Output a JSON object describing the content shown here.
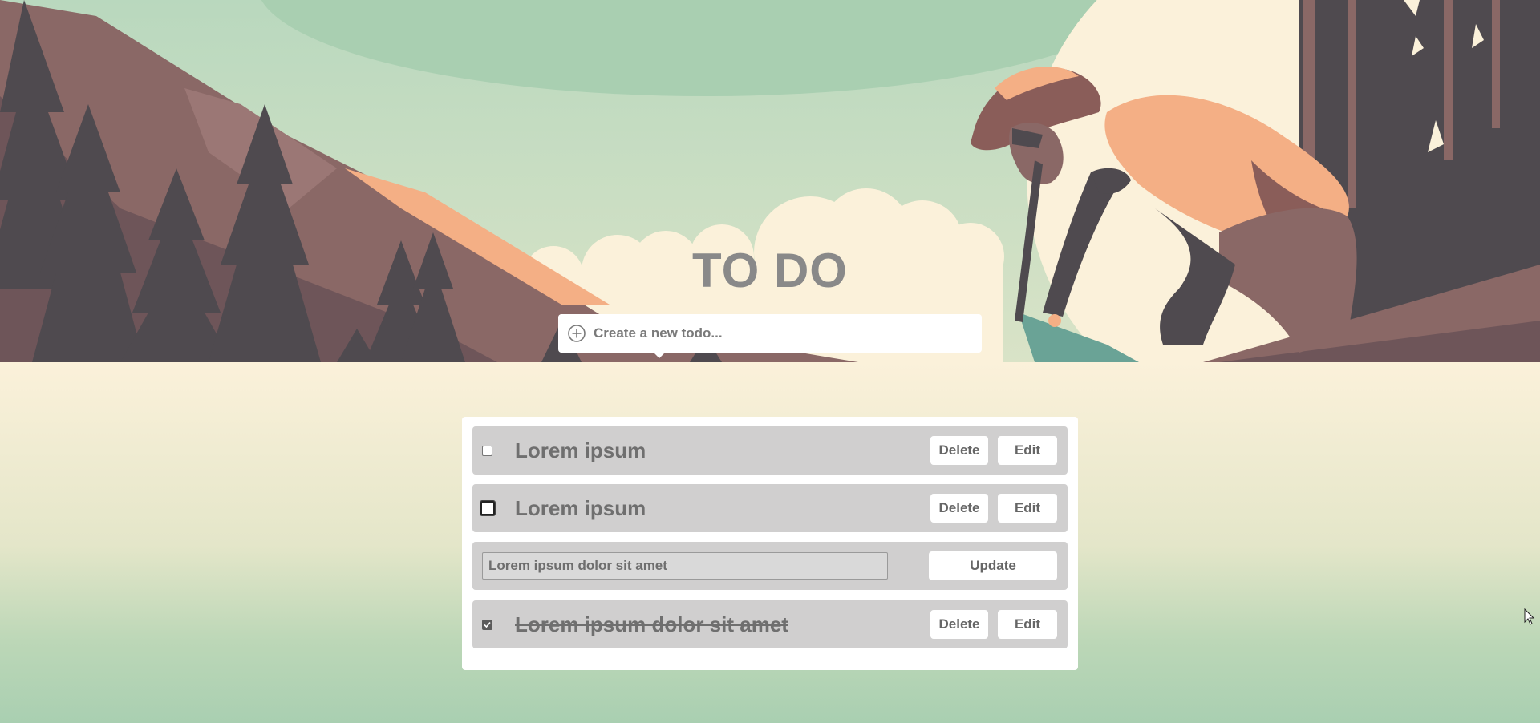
{
  "app": {
    "title": "TO DO"
  },
  "new_todo": {
    "placeholder": "Create a new todo...",
    "value": "",
    "icon": "plus-circle-icon"
  },
  "todos": [
    {
      "text": "Lorem ipsum",
      "completed": false,
      "focused": false,
      "editing": false,
      "delete_label": "Delete",
      "edit_label": "Edit"
    },
    {
      "text": "Lorem ipsum",
      "completed": false,
      "focused": true,
      "editing": false,
      "delete_label": "Delete",
      "edit_label": "Edit"
    },
    {
      "text": "Lorem ipsum dolor sit amet",
      "completed": false,
      "focused": false,
      "editing": true,
      "update_label": "Update"
    },
    {
      "text": "Lorem ipsum dolor sit amet",
      "completed": true,
      "focused": false,
      "editing": false,
      "delete_label": "Delete",
      "edit_label": "Edit"
    }
  ],
  "colors": {
    "sky_green": "#a9cfb1",
    "sun_cream": "#fbf1da",
    "mountain": "#8a6866",
    "trees": "#4f4a4f",
    "jacket": "#f4af85",
    "title_text": "#898989",
    "row_bg": "#d0cfcf"
  }
}
